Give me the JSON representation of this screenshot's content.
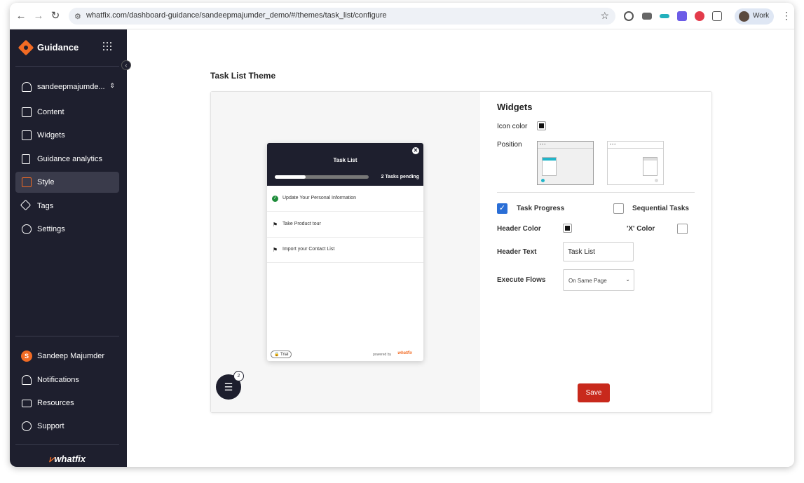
{
  "browser": {
    "url": "whatfix.com/dashboard-guidance/sandeepmajumder_demo/#/themes/task_list/configure",
    "profile_label": "Work"
  },
  "sidebar": {
    "brand": "Guidance",
    "account": "sandeepmajumde...",
    "items": [
      {
        "label": "Content",
        "icon": "content-icon"
      },
      {
        "label": "Widgets",
        "icon": "widgets-icon"
      },
      {
        "label": "Guidance analytics",
        "icon": "analytics-icon"
      },
      {
        "label": "Style",
        "icon": "style-icon",
        "active": true
      },
      {
        "label": "Tags",
        "icon": "tag-icon"
      },
      {
        "label": "Settings",
        "icon": "gear-icon"
      }
    ],
    "user": {
      "initial": "S",
      "name": "Sandeep Majumder"
    },
    "bottom_items": [
      {
        "label": "Notifications",
        "icon": "bell-icon"
      },
      {
        "label": "Resources",
        "icon": "book-icon"
      },
      {
        "label": "Support",
        "icon": "help-icon"
      }
    ],
    "logo_text": "whatfix"
  },
  "main": {
    "page_title": "Task List Theme"
  },
  "preview": {
    "title": "Task List",
    "pending": "2 Tasks pending",
    "progress": 0.33,
    "tasks": [
      {
        "label": "Update Your Personal Information",
        "done": true
      },
      {
        "label": "Take Product tour",
        "done": false
      },
      {
        "label": "Import your Contact List",
        "done": false
      }
    ],
    "trial_badge": "Trial",
    "powered_by": "powered by",
    "powered_logo": "whatfix",
    "launcher_badge": "2"
  },
  "settings": {
    "heading": "Widgets",
    "icon_color_label": "Icon color",
    "position_label": "Position",
    "task_progress_label": "Task Progress",
    "task_progress_checked": true,
    "sequential_tasks_label": "Sequential Tasks",
    "sequential_tasks_checked": false,
    "header_color_label": "Header Color",
    "x_color_label": "'X' Color",
    "header_text_label": "Header Text",
    "header_text_value": "Task List",
    "execute_flows_label": "Execute Flows",
    "execute_flows_value": "On Same Page",
    "save_label": "Save",
    "colors": {
      "icon": "#111111",
      "header": "#111111",
      "x": "#ffffff"
    }
  },
  "colors": {
    "sidebar_bg": "#1e1f2e",
    "accent": "#f26b24",
    "save_button": "#c8291c",
    "checkbox_blue": "#2a6ed6",
    "position_accent": "#21b5c9"
  }
}
